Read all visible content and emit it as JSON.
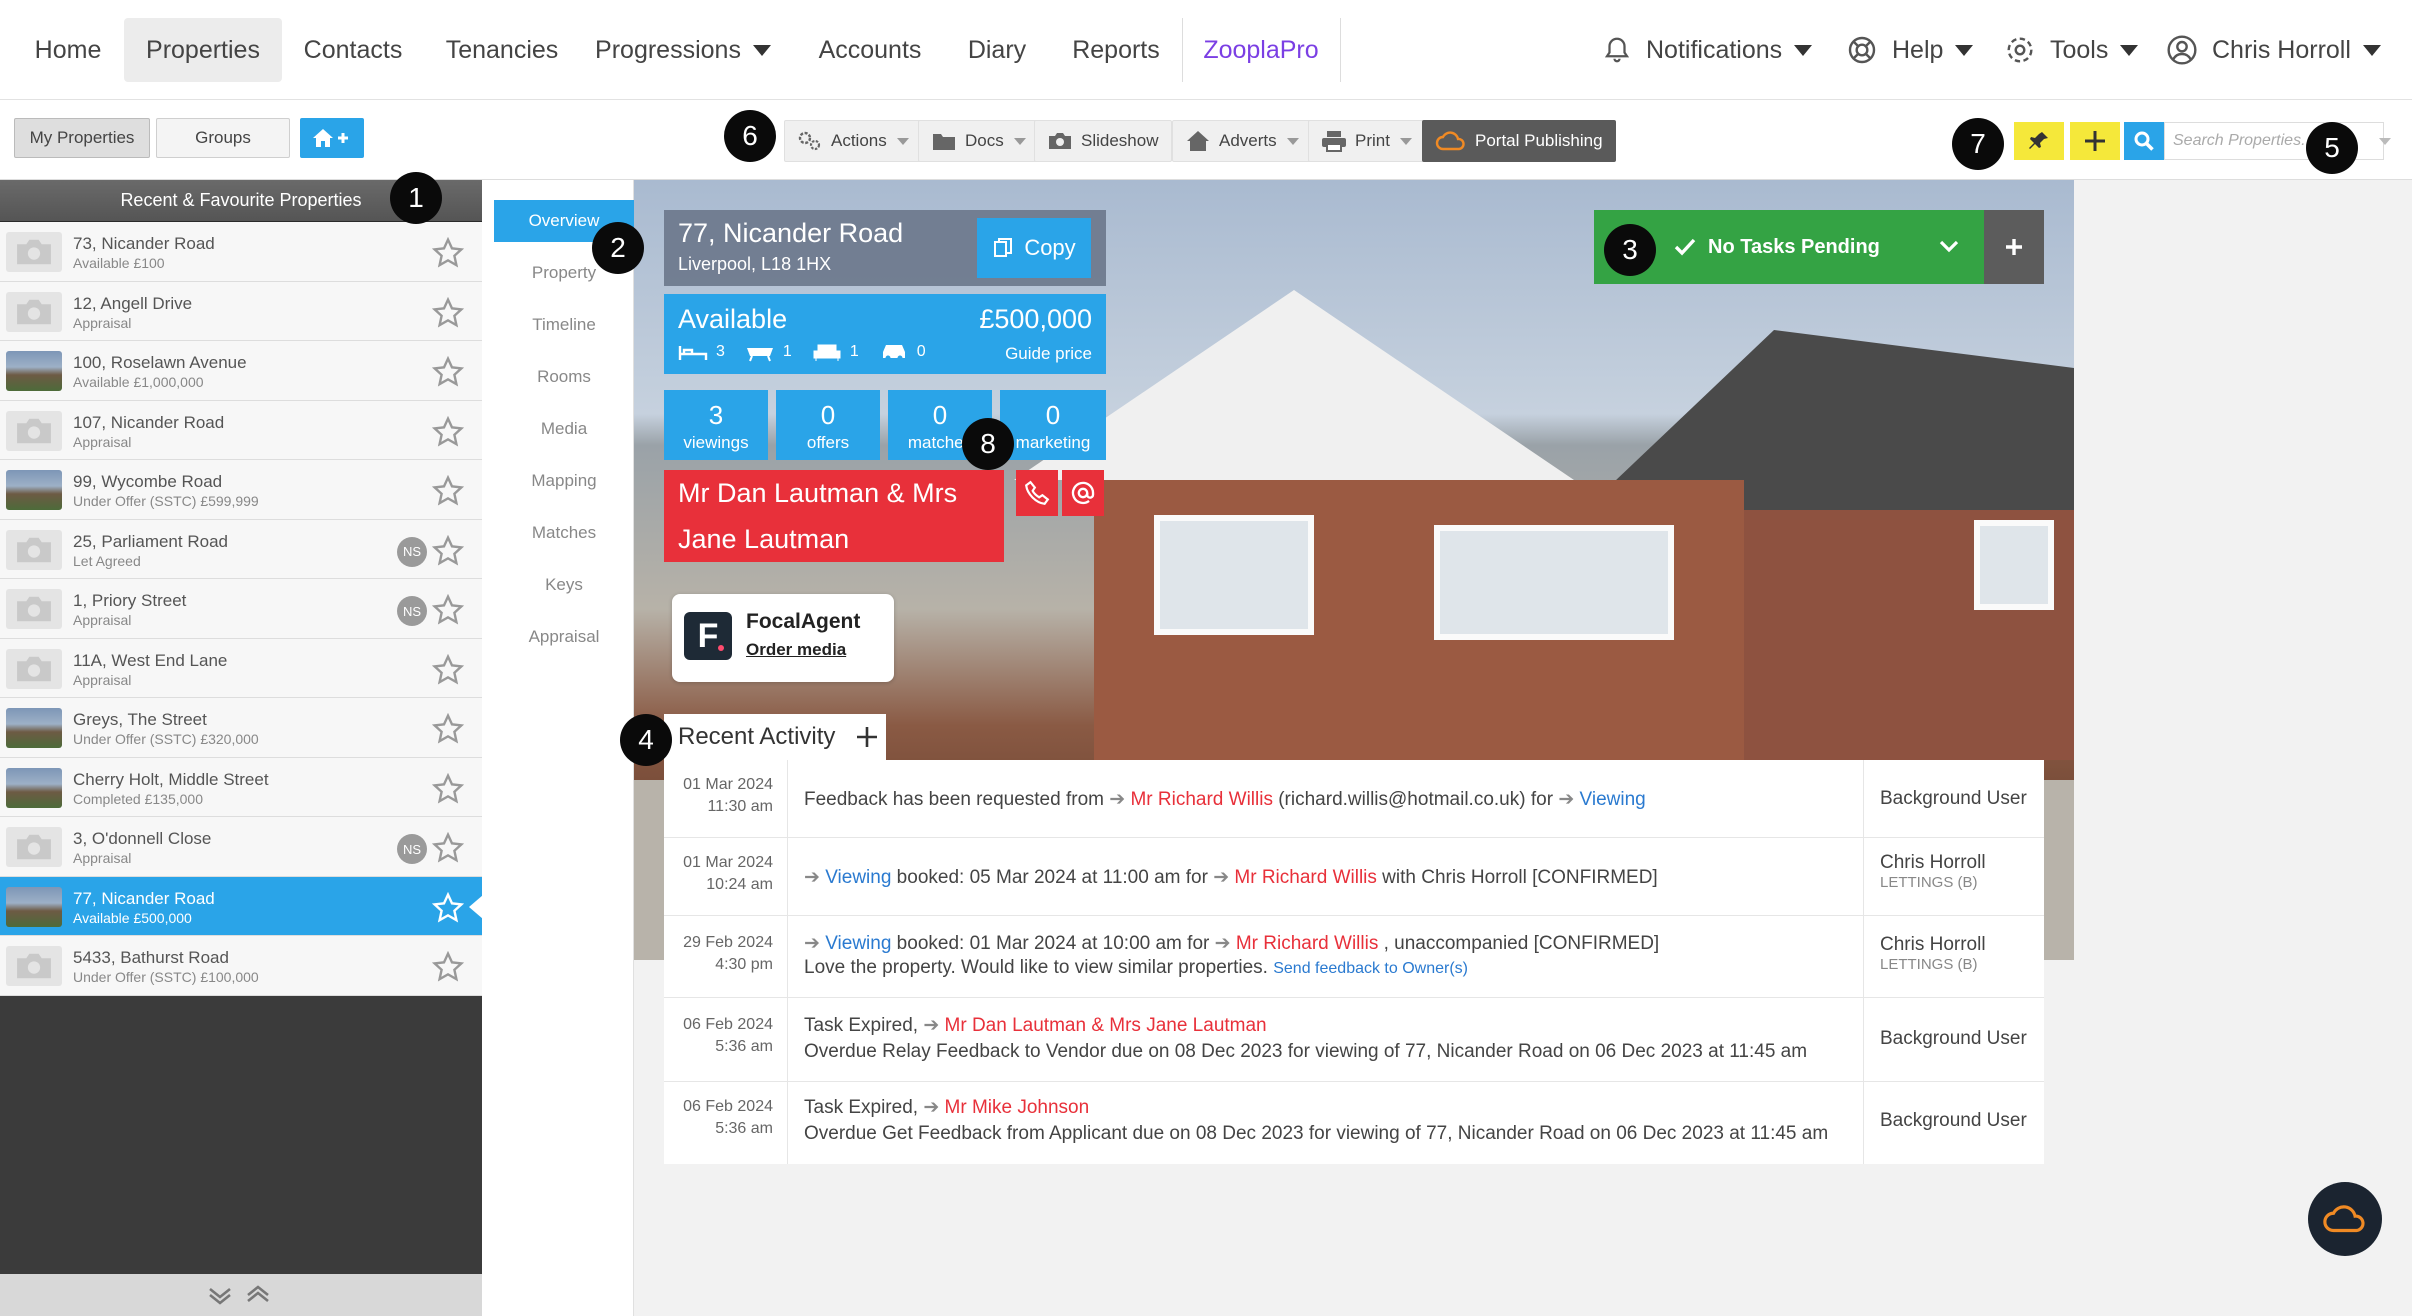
{
  "nav": {
    "items": [
      "Home",
      "Properties",
      "Contacts",
      "Tenancies",
      "Progressions",
      "Accounts",
      "Diary",
      "Reports",
      "ZooplaPro"
    ],
    "notifications": "Notifications",
    "help": "Help",
    "tools": "Tools",
    "user": "Chris Horroll",
    "zoopla_color": "#7b3fe4"
  },
  "toolbar": {
    "my_properties": "My Properties",
    "groups": "Groups",
    "actions": "Actions",
    "docs": "Docs",
    "slideshow": "Slideshow",
    "adverts": "Adverts",
    "print": "Print",
    "portal_publishing": "Portal Publishing",
    "search_placeholder": "Search Properties..."
  },
  "badges": [
    "1",
    "2",
    "3",
    "4",
    "5",
    "6",
    "7",
    "8"
  ],
  "sidebar": {
    "header": "Recent & Favourite Properties",
    "items": [
      {
        "address": "73, Nicander Road",
        "status": "Available £100",
        "thumb": "camera",
        "ns": ""
      },
      {
        "address": "12, Angell Drive",
        "status": "Appraisal",
        "thumb": "camera",
        "ns": ""
      },
      {
        "address": "100, Roselawn Avenue",
        "status": "Available £1,000,000",
        "thumb": "photo",
        "ns": ""
      },
      {
        "address": "107, Nicander Road",
        "status": "Appraisal",
        "thumb": "camera",
        "ns": ""
      },
      {
        "address": "99, Wycombe Road",
        "status": "Under Offer (SSTC) £599,999",
        "thumb": "photo",
        "ns": ""
      },
      {
        "address": "25, Parliament Road",
        "status": "Let Agreed",
        "thumb": "camera",
        "ns": "NS"
      },
      {
        "address": "1, Priory Street",
        "status": "Appraisal",
        "thumb": "camera",
        "ns": "NS"
      },
      {
        "address": "11A, West End Lane",
        "status": "Appraisal",
        "thumb": "camera",
        "ns": ""
      },
      {
        "address": "Greys, The Street",
        "status": "Under Offer (SSTC) £320,000",
        "thumb": "photo",
        "ns": ""
      },
      {
        "address": "Cherry Holt, Middle Street",
        "status": "Completed £135,000",
        "thumb": "photo",
        "ns": ""
      },
      {
        "address": "3, O'donnell Close",
        "status": "Appraisal",
        "thumb": "camera",
        "ns": "NS"
      },
      {
        "address": "77, Nicander Road",
        "status": "Available £500,000",
        "thumb": "photo",
        "ns": "",
        "active": true
      },
      {
        "address": "5433, Bathurst Road",
        "status": "Under Offer (SSTC) £100,000",
        "thumb": "camera",
        "ns": ""
      }
    ]
  },
  "subnav": [
    "Overview",
    "Property",
    "Timeline",
    "Rooms",
    "Media",
    "Mapping",
    "Matches",
    "Keys",
    "Appraisal"
  ],
  "property": {
    "address_line1": "77, Nicander Road",
    "address_line2": "Liverpool, L18 1HX",
    "copy_label": "Copy",
    "status": "Available",
    "price": "£500,000",
    "price_qualifier": "Guide price",
    "bedrooms": "3",
    "bathrooms": "1",
    "receptions": "1",
    "parking": "0",
    "stats": [
      {
        "value": "3",
        "label": "viewings"
      },
      {
        "value": "0",
        "label": "offers"
      },
      {
        "value": "0",
        "label": "matches"
      },
      {
        "value": "0",
        "label": "marketing"
      }
    ],
    "vendor_line1": "Mr Dan Lautman & Mrs",
    "vendor_line2": "Jane Lautman",
    "focal_name": "FocalAgent",
    "focal_link": "Order media"
  },
  "tasks": {
    "label": "No Tasks Pending"
  },
  "activity": {
    "title": "Recent Activity",
    "rows": [
      {
        "date": "01 Mar 2024",
        "time": "11:30 am",
        "pre": "Feedback has been requested from ",
        "name": "Mr Richard Willis",
        "mid": " (richard.willis@hotmail.co.uk) for ",
        "link": "Viewing",
        "user": "Background User",
        "user_sub": ""
      },
      {
        "date": "01 Mar 2024",
        "time": "10:24 am",
        "link": "Viewing",
        "pre": " booked: 05 Mar 2024 at 11:00 am for ",
        "name": "Mr Richard Willis",
        "post": " with Chris Horroll [CONFIRMED]",
        "user": "Chris Horroll",
        "user_sub": "LETTINGS (B)"
      },
      {
        "date": "29 Feb 2024",
        "time": "4:30 pm",
        "link": "Viewing",
        "pre": " booked: 01 Mar 2024 at 10:00 am for ",
        "name": "Mr Richard Willis",
        "post": " , unaccompanied [CONFIRMED]",
        "line2": "Love the property. Would like to view similar properties. ",
        "line2_link": "Send feedback to Owner(s)",
        "user": "Chris Horroll",
        "user_sub": "LETTINGS (B)"
      },
      {
        "date": "06 Feb 2024",
        "time": "5:36 am",
        "pre": "Task Expired, ",
        "name": "Mr Dan Lautman & Mrs Jane Lautman",
        "line2": "Overdue Relay Feedback to Vendor due on 08 Dec 2023 for viewing of 77, Nicander Road on 06 Dec 2023 at 11:45 am",
        "user": "Background User",
        "user_sub": ""
      },
      {
        "date": "06 Feb 2024",
        "time": "5:36 am",
        "pre": "Task Expired, ",
        "name": "Mr Mike Johnson",
        "line2": "Overdue Get Feedback from Applicant due on 08 Dec 2023 for viewing of 77, Nicander Road on 06 Dec 2023 at 11:45 am",
        "user": "Background User",
        "user_sub": ""
      }
    ]
  },
  "colors": {
    "accent_blue": "#2aa4e8",
    "vendor_red": "#e8303a",
    "task_green": "#34a344"
  }
}
